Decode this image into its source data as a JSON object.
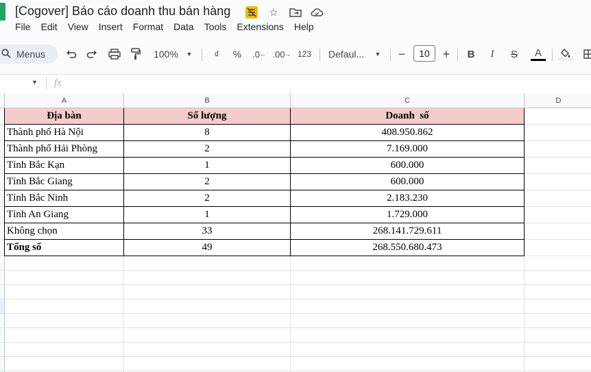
{
  "doc_title": "[Cogover] Báo cáo doanh thu bán hàng",
  "menu": [
    "File",
    "Edit",
    "View",
    "Insert",
    "Format",
    "Data",
    "Tools",
    "Extensions",
    "Help"
  ],
  "toolbar": {
    "menus_label": "Menus",
    "zoom": "100%",
    "currency": "₫",
    "percent": "%",
    "dec_decrease": ".0",
    "dec_increase": ".00",
    "number_format": "123",
    "font_name": "Defaul...",
    "font_size": "10",
    "bold": "B",
    "italic": "I",
    "strike": "S",
    "text_color": "A"
  },
  "formula_bar": {
    "fx": "fx"
  },
  "columns": [
    "A",
    "B",
    "C",
    "D"
  ],
  "table": {
    "headers": [
      "Địa bàn",
      "Số lượng",
      "Doanh  số"
    ],
    "rows": [
      [
        "Thành phố Hà Nội",
        "8",
        "408.950.862"
      ],
      [
        "Thành phố Hải Phòng",
        "2",
        "7.169.000"
      ],
      [
        "Tỉnh Bắc Kạn",
        "1",
        "600.000"
      ],
      [
        "Tỉnh Bắc Giang",
        "2",
        "600.000"
      ],
      [
        "Tỉnh Bắc Ninh",
        "2",
        "2.183.230"
      ],
      [
        "Tỉnh An Giang",
        "1",
        "1.729.000"
      ],
      [
        "Không chọn",
        "33",
        "268.141.729.611"
      ]
    ],
    "total": [
      "Tổng số",
      "49",
      "268.550.680.473"
    ]
  },
  "colors": {
    "header_fill": "#f4cccc",
    "sheets_green": "#1fa463",
    "accent": "#f2b90f"
  }
}
